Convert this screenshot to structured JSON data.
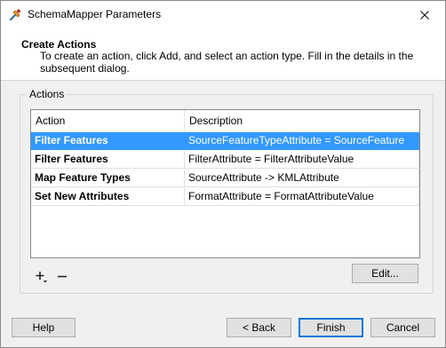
{
  "window": {
    "title": "SchemaMapper Parameters"
  },
  "header": {
    "title": "Create Actions",
    "description": "To create an action, click Add, and select an action type. Fill in the details in the subsequent dialog."
  },
  "actions_group": {
    "label": "Actions",
    "columns": {
      "action": "Action",
      "description": "Description"
    },
    "rows": [
      {
        "action": "Filter Features",
        "description": "SourceFeatureTypeAttribute = SourceFeature",
        "selected": true
      },
      {
        "action": "Filter Features",
        "description": "FilterAttribute = FilterAttributeValue",
        "selected": false
      },
      {
        "action": "Map Feature Types",
        "description": "SourceAttribute -> KMLAttribute",
        "selected": false
      },
      {
        "action": "Set New Attributes",
        "description": "FormatAttribute = FormatAttributeValue",
        "selected": false
      }
    ],
    "edit_label": "Edit..."
  },
  "footer": {
    "help_label": "Help",
    "back_label": "< Back",
    "finish_label": "Finish",
    "cancel_label": "Cancel"
  },
  "colors": {
    "selection": "#3399ff",
    "default_button_border": "#0078d7"
  },
  "icons": {
    "app": "tool-icon",
    "close": "close-icon",
    "add": "add-plus-icon",
    "remove": "remove-minus-icon"
  }
}
